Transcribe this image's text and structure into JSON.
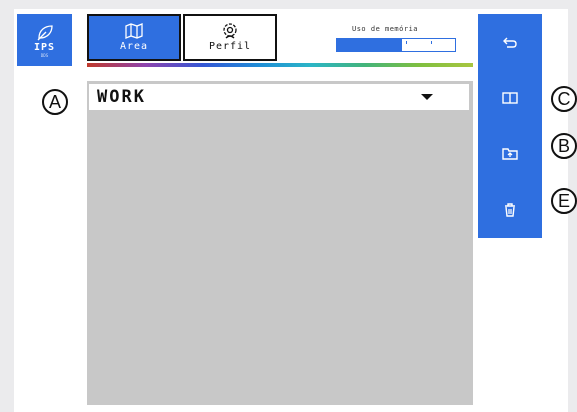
{
  "header": {
    "ips_button": {
      "label": "IPS",
      "sublabel": "DDS"
    },
    "tabs": [
      {
        "label": "Area",
        "active": true
      },
      {
        "label": "Perfil",
        "active": false
      }
    ],
    "memory": {
      "label": "Uso de memória",
      "usage_fraction": 0.55
    }
  },
  "field_selector": {
    "value": "WORK"
  },
  "callouts": {
    "a": "A",
    "b": "B",
    "c": "C",
    "e": "E"
  },
  "colors": {
    "accent": "#2f6fe0",
    "content_bg": "#c8c8c8"
  }
}
